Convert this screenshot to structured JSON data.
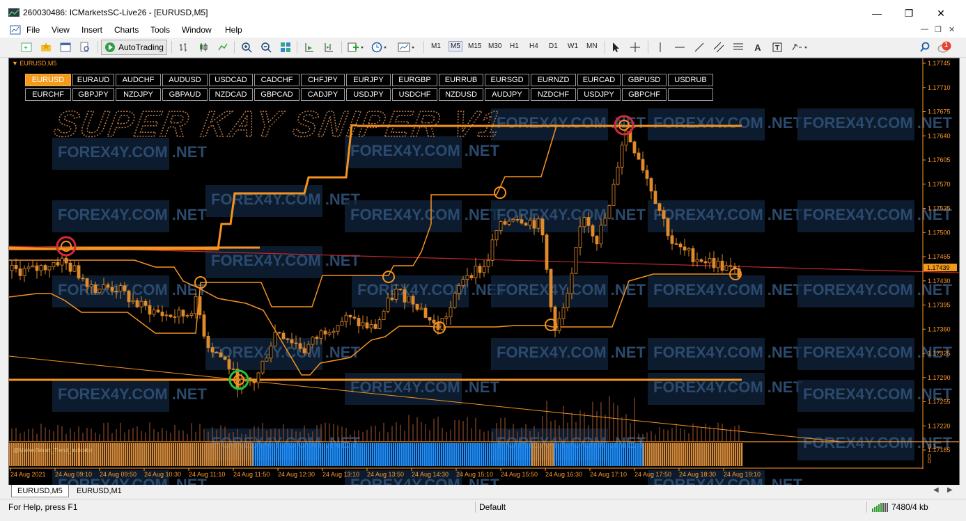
{
  "window": {
    "title": "260030486: ICMarketsSC-Live26 - [EURUSD,M5]"
  },
  "menu": [
    "File",
    "View",
    "Insert",
    "Charts",
    "Tools",
    "Window",
    "Help"
  ],
  "toolbar": {
    "autotrading_label": "AutoTrading",
    "timeframes": [
      "M1",
      "M5",
      "M15",
      "M30",
      "H1",
      "H4",
      "D1",
      "W1",
      "MN"
    ],
    "selected_timeframe": "M5",
    "notification_count": "1"
  },
  "chart": {
    "tab_label": "EURUSD,M5",
    "indicator_title": "SUPER KAY SNIPER V1",
    "watermark": "FOREX4Y.COM .NET",
    "symbol_rows": [
      [
        "EURUSD",
        "EURAUD",
        "AUDCHF",
        "AUDUSD",
        "USDCAD",
        "CADCHF",
        "CHFJPY",
        "EURJPY",
        "EURGBP",
        "EURRUB",
        "EURSGD",
        "EURNZD",
        "EURCAD",
        "GBPUSD",
        "USDRUB"
      ],
      [
        "EURCHF",
        "GBPJPY",
        "NZDJPY",
        "GBPAUD",
        "NZDCAD",
        "GBPCAD",
        "CADJPY",
        "USDJPY",
        "USDCHF",
        "NZDUSD",
        "AUDJPY",
        "NZDCHF",
        "USDJPY",
        "GBPCHF",
        ""
      ]
    ],
    "active_symbol": "EURUSD",
    "current_price": "1.17439",
    "price_axis": [
      "1.17745",
      "1.17710",
      "1.17675",
      "1.17640",
      "1.17605",
      "1.17570",
      "1.17535",
      "1.17500",
      "1.17465",
      "1.17430",
      "1.17395",
      "1.17360",
      "1.17325",
      "1.17290",
      "1.17255",
      "1.17220",
      "1.17185"
    ],
    "sub_axis": [
      "0.1",
      "0",
      "0"
    ],
    "sub_indicator_label": "@MarketSmart_Trend_Indicator",
    "time_axis": [
      "24 Aug 2021",
      "24 Aug 09:10",
      "24 Aug 09:50",
      "24 Aug 10:30",
      "24 Aug 11:10",
      "24 Aug 11:50",
      "24 Aug 12:30",
      "24 Aug 13:10",
      "24 Aug 13:50",
      "24 Aug 14:30",
      "24 Aug 15:10",
      "24 Aug 15:50",
      "24 Aug 16:30",
      "24 Aug 17:10",
      "24 Aug 17:50",
      "24 Aug 18:30",
      "24 Aug 19:10"
    ],
    "colors": {
      "accent": "#f7931e",
      "background": "#000000",
      "trend_blue": "#1e90ff",
      "trend_orange": "#d48a3a",
      "red_line": "#c0282d",
      "buy_circle": "#22c43a",
      "sell_circle": "#d8283c"
    }
  },
  "tabs": [
    "EURUSD,M5",
    "EURUSD,M1"
  ],
  "status": {
    "help": "For Help, press F1",
    "profile": "Default",
    "traffic": "7480/4 kb"
  }
}
